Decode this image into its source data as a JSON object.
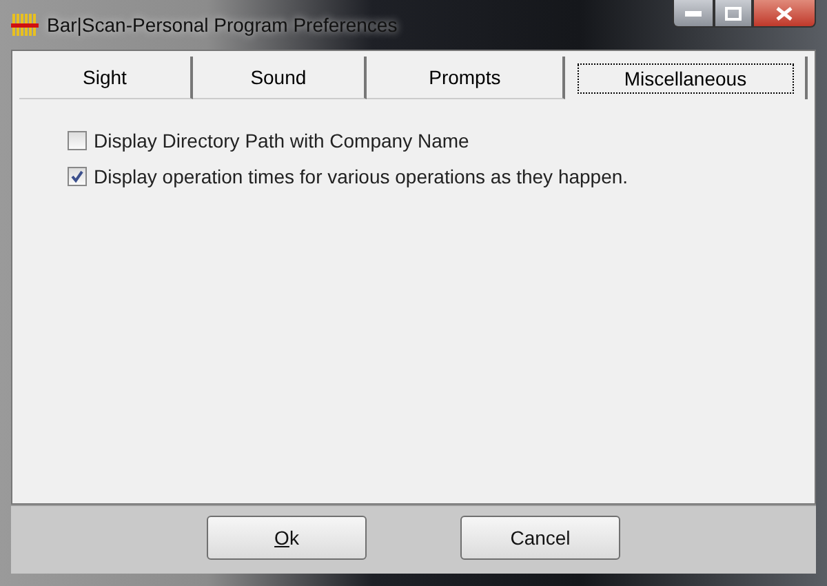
{
  "window": {
    "title": "Bar|Scan-Personal Program Preferences"
  },
  "tabs": [
    {
      "label": "Sight",
      "selected": false
    },
    {
      "label": "Sound",
      "selected": false
    },
    {
      "label": "Prompts",
      "selected": false
    },
    {
      "label": "Miscellaneous",
      "selected": true
    }
  ],
  "options": [
    {
      "label": "Display Directory Path with Company Name",
      "checked": false
    },
    {
      "label": "Display operation times for various operations as they happen.",
      "checked": true
    }
  ],
  "buttons": [
    {
      "label": "Ok",
      "mnemonic": true
    },
    {
      "label": "Cancel",
      "mnemonic": false
    }
  ]
}
